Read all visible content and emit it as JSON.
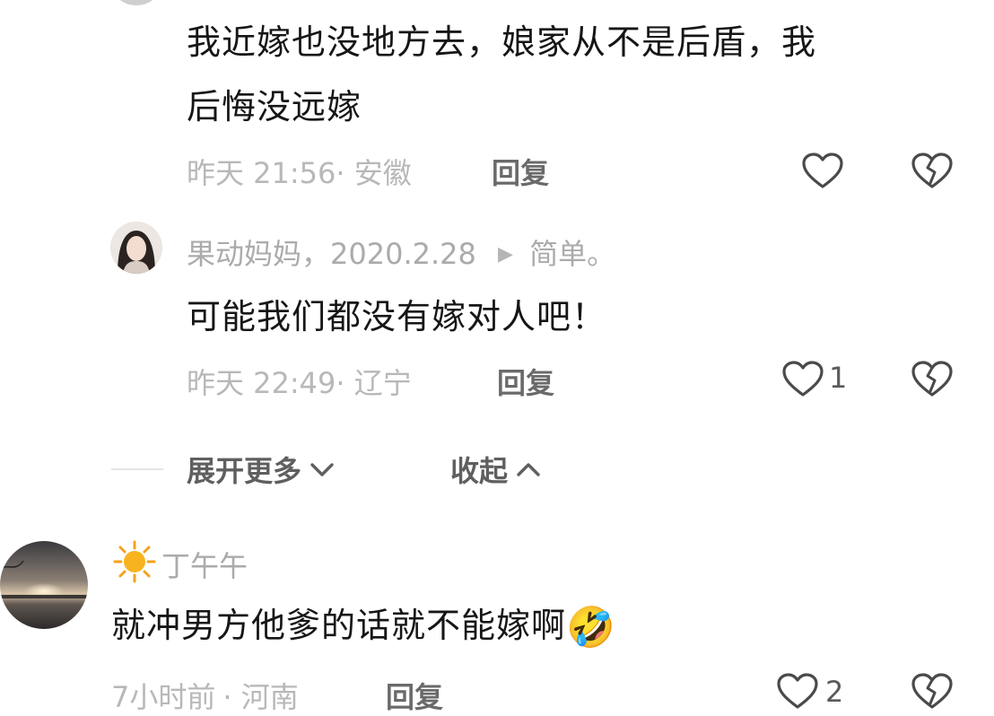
{
  "comment1": {
    "text_line1": "我近嫁也没地方去，娘家从不是后盾，我",
    "text_line2": "后悔没远嫁",
    "time": "昨天 21:56",
    "location": "· 安徽",
    "reply_label": "回复"
  },
  "comment2": {
    "author": "果动妈妈，2020.2.28",
    "reply_to_arrow": "▶",
    "reply_to": "简单。",
    "text": "可能我们都没有嫁对人吧！",
    "time": "昨天 22:49",
    "location": "· 辽宁",
    "reply_label": "回复",
    "like_count": "1"
  },
  "thread_controls": {
    "expand_label": "展开更多",
    "collapse_label": "收起"
  },
  "comment3": {
    "author": "丁午午",
    "text": "就冲男方他爹的话就不能嫁啊",
    "emoji": "🤣",
    "time": "7小时前",
    "location": "· 河南",
    "reply_label": "回复",
    "like_count": "2"
  },
  "colors": {
    "meta_gray": "#b8b8b8",
    "icon_gray": "#4a4a4a"
  }
}
